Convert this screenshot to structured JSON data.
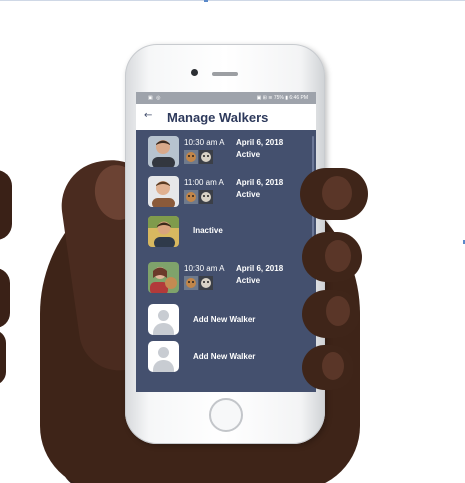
{
  "screen": {
    "status_bar": {
      "left_icons": "▣ ◎",
      "right_text": "▣ ⊞ ≋ 75% ▮ 6:46 PM"
    },
    "header": {
      "back_icon": "←",
      "title": "Manage Walkers"
    },
    "walkers": [
      {
        "time": "10:30 am A",
        "date": "April 6, 2018",
        "status": "Active"
      },
      {
        "time": "11:00 am A",
        "date": "April 6, 2018",
        "status": "Active"
      },
      {
        "status": "Inactive"
      },
      {
        "time": "10:30 am A",
        "date": "April 6, 2018",
        "status": "Active"
      }
    ],
    "add_new": [
      {
        "label": "Add New Walker"
      },
      {
        "label": "Add New Walker"
      }
    ]
  },
  "colors": {
    "screen_bg": "#44506e",
    "title": "#2e3a5c",
    "status_bar": "#9ea3ab"
  },
  "icons": {
    "back": "back-arrow-icon",
    "placeholder": "person-placeholder-icon",
    "dog": "dog-photo-icon"
  }
}
